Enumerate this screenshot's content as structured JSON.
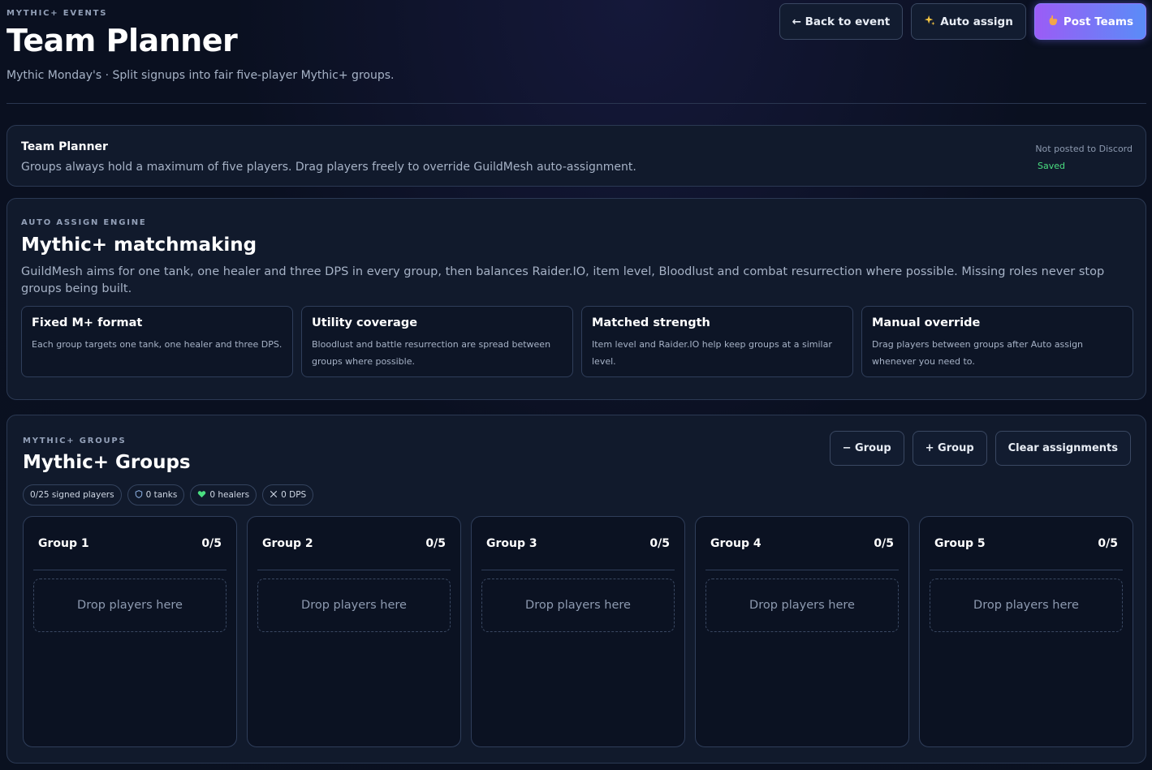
{
  "header": {
    "eyebrow": "MYTHIC+ EVENTS",
    "title": "Team Planner",
    "subtitle": "Mythic Monday's · Split signups into fair five-player Mythic+ groups.",
    "actions": {
      "back": "← Back to event",
      "auto": "Auto assign",
      "post": "Post Teams"
    }
  },
  "status_panel": {
    "title": "Team Planner",
    "description": "Groups always hold a maximum of five players. Drag players freely to override GuildMesh auto-assignment.",
    "discord_status": "Not posted to Discord",
    "save_status": "Saved"
  },
  "engine_panel": {
    "eyebrow": "AUTO ASSIGN ENGINE",
    "title": "Mythic+ matchmaking",
    "description": "GuildMesh aims for one tank, one healer and three DPS in every group, then balances Raider.IO, item level, Bloodlust and combat resurrection where possible. Missing roles never stop groups being built.",
    "cards": [
      {
        "title": "Fixed M+ format",
        "text": "Each group targets one tank, one healer and three DPS."
      },
      {
        "title": "Utility coverage",
        "text": "Bloodlust and battle resurrection are spread between groups where possible."
      },
      {
        "title": "Matched strength",
        "text": "Item level and Raider.IO help keep groups at a similar level."
      },
      {
        "title": "Manual override",
        "text": "Drag players between groups after Auto assign whenever you need to."
      }
    ]
  },
  "groups_panel": {
    "eyebrow": "MYTHIC+ GROUPS",
    "title": "Mythic+ Groups",
    "actions": {
      "remove": "− Group",
      "add": "+ Group",
      "clear": "Clear assignments"
    },
    "pills": {
      "signed": "0/25 signed players",
      "tanks": "0 tanks",
      "healers": "0 healers",
      "dps": "0 DPS"
    },
    "groups": [
      {
        "name": "Group 1",
        "count": "0/5",
        "drop": "Drop players here"
      },
      {
        "name": "Group 2",
        "count": "0/5",
        "drop": "Drop players here"
      },
      {
        "name": "Group 3",
        "count": "0/5",
        "drop": "Drop players here"
      },
      {
        "name": "Group 4",
        "count": "0/5",
        "drop": "Drop players here"
      },
      {
        "name": "Group 5",
        "count": "0/5",
        "drop": "Drop players here"
      }
    ]
  },
  "icons": {
    "auto": "sparkles-icon",
    "post": "hand-icon",
    "tank": "shield-icon",
    "healer": "heart-icon",
    "dps": "swords-icon"
  },
  "colors": {
    "accent_start": "#9b5cf6",
    "accent_end": "#5a8cf7",
    "saved": "#4ade80",
    "healer": "#4ade80"
  }
}
